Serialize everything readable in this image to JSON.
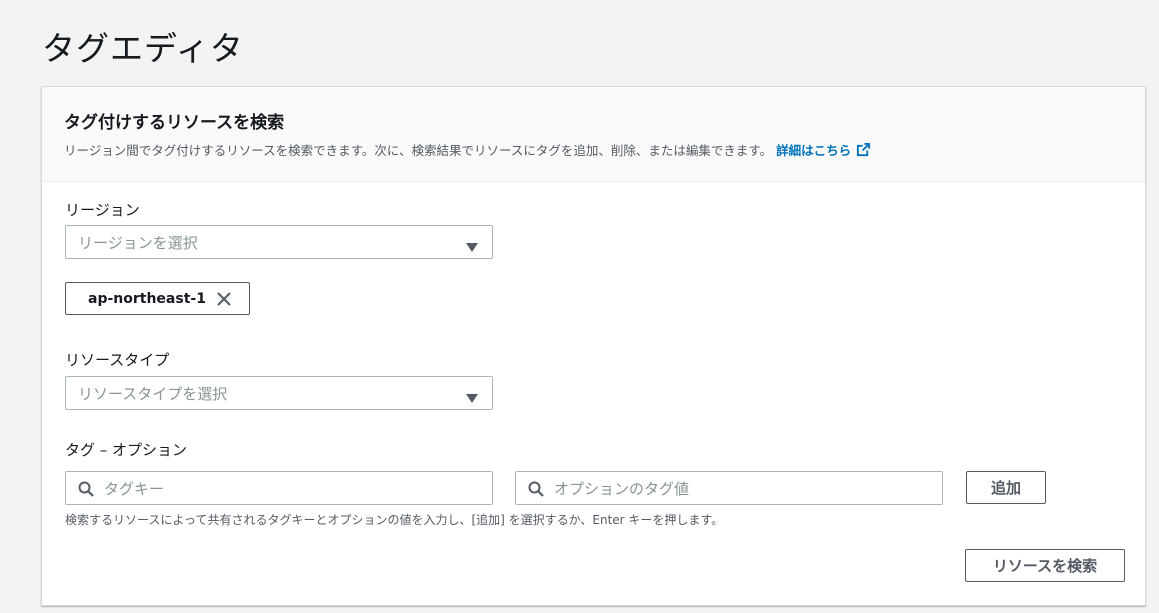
{
  "page": {
    "title": "タグエディタ"
  },
  "panel": {
    "title": "タグ付けするリソースを検索",
    "description": "リージョン間でタグ付けするリソースを検索できます。次に、検索結果でリソースにタグを追加、削除、または編集できます。",
    "learn_more": "詳細はこちら"
  },
  "region": {
    "label": "リージョン",
    "placeholder": "リージョンを選択",
    "selected_tokens": [
      "ap-northeast-1"
    ]
  },
  "resource_type": {
    "label": "リソースタイプ",
    "placeholder": "リソースタイプを選択"
  },
  "tags": {
    "label": "タグ – オプション",
    "key_placeholder": "タグキー",
    "value_placeholder": "オプションのタグ値",
    "add_button": "追加",
    "hint": "検索するリソースによって共有されるタグキーとオプションの値を入力し、[追加] を選択するか、Enter キーを押します。"
  },
  "search_button": "リソースを検索",
  "colors": {
    "link": "#0073bb",
    "border": "#aab7b8",
    "text": "#16191f"
  }
}
